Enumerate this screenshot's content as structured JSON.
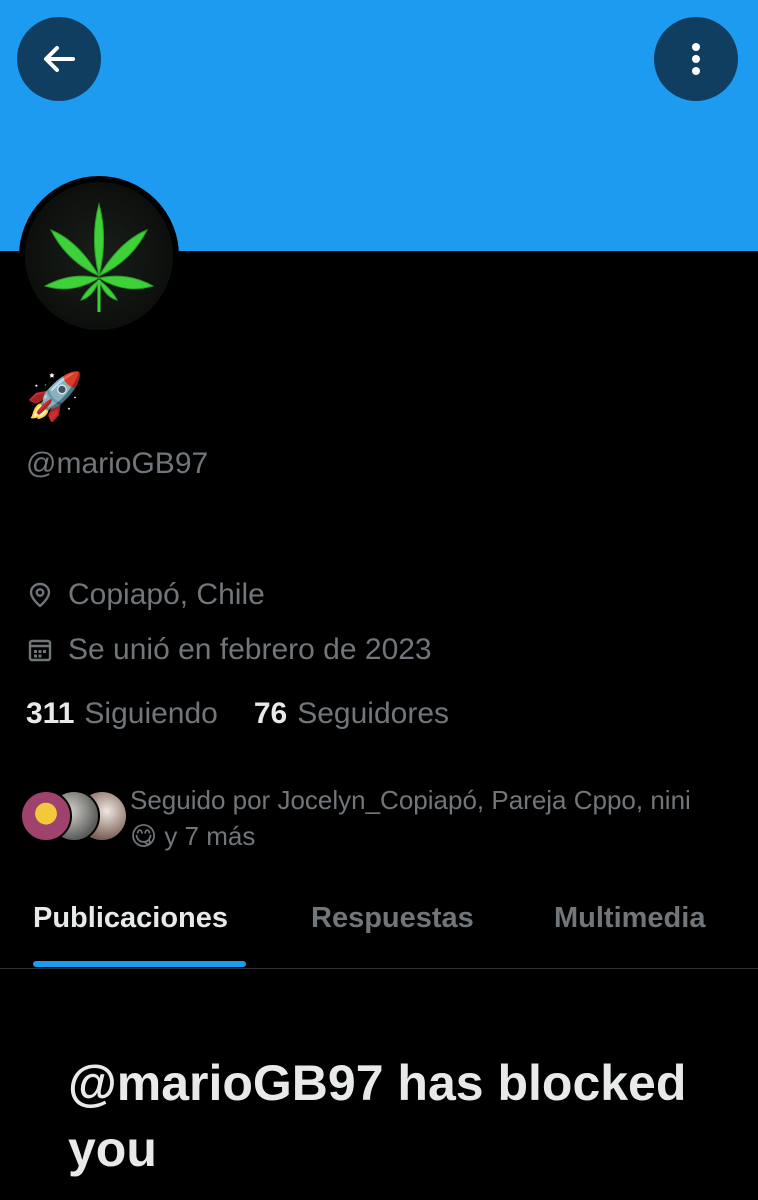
{
  "colors": {
    "banner": "#1d9bf0",
    "background": "#000000",
    "accent": "#1d9bf0",
    "primary_text": "#e7e9ea",
    "secondary_text": "#71767b"
  },
  "header": {
    "back_icon": "arrow-left-icon",
    "more_icon": "vertical-dots-icon"
  },
  "profile": {
    "display_name": "🚀",
    "handle": "@marioGB97",
    "location": "Copiapó, Chile",
    "joined": "Se unió en febrero de 2023",
    "following_count": "311",
    "following_label": "Siguiendo",
    "followers_count": "76",
    "followers_label": "Seguidores",
    "followed_by": "Seguido por Jocelyn_Copiapó, Pareja Cppo, nini",
    "followed_by_more": "😋 y 7 más"
  },
  "tabs": [
    {
      "label": "Publicaciones",
      "active": true
    },
    {
      "label": "Respuestas",
      "active": false
    },
    {
      "label": "Multimedia",
      "active": false
    }
  ],
  "blocked_message": "@marioGB97 has blocked you"
}
